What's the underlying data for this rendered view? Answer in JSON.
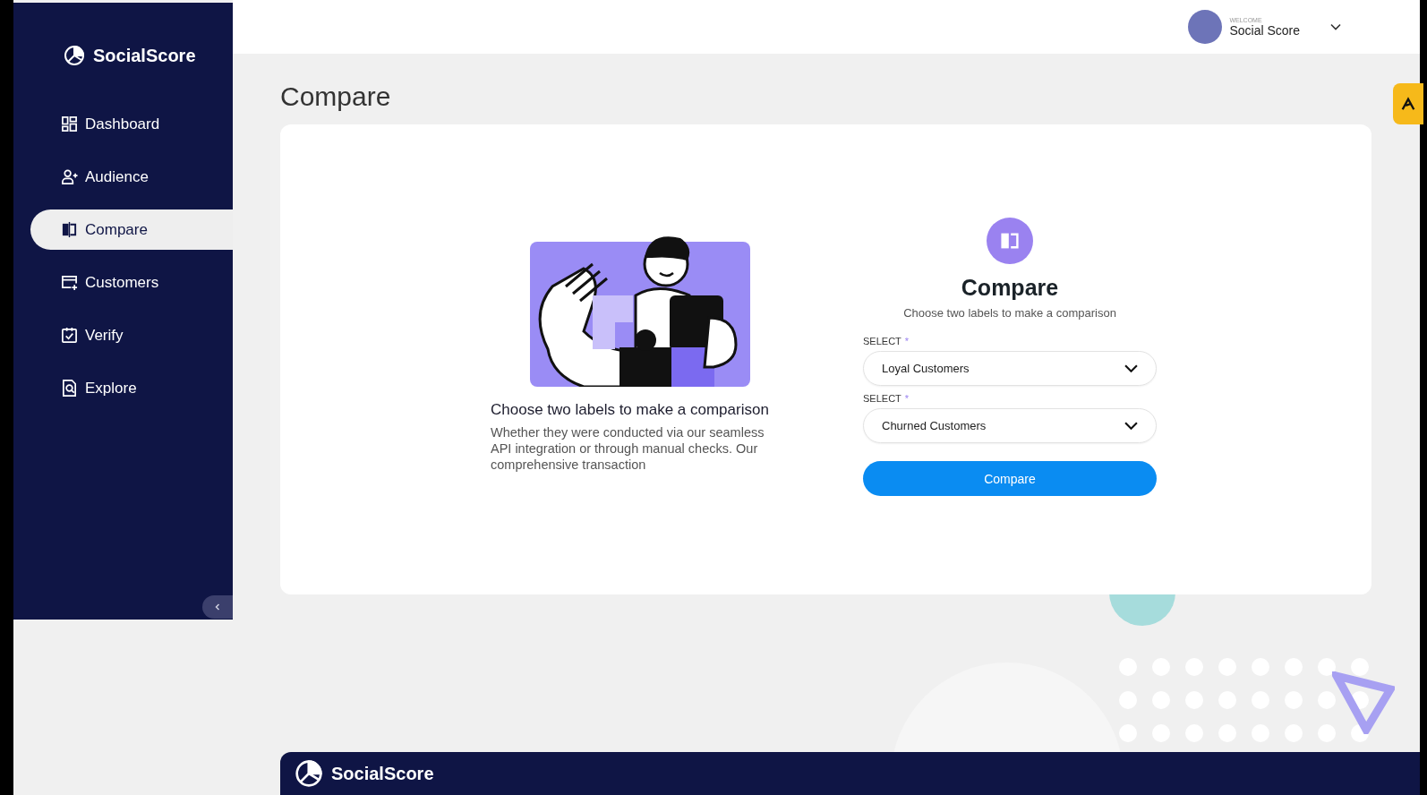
{
  "brand": "SocialScore",
  "nav": [
    {
      "label": "Dashboard",
      "kind": "dashboard",
      "selected": false
    },
    {
      "label": "Audience",
      "kind": "audience",
      "selected": false
    },
    {
      "label": "Compare",
      "kind": "compare",
      "selected": true
    },
    {
      "label": "Customers",
      "kind": "customers",
      "selected": false
    },
    {
      "label": "Verify",
      "kind": "verify",
      "selected": false
    },
    {
      "label": "Explore",
      "kind": "explore",
      "selected": false
    }
  ],
  "user": {
    "greeting": "WELCOME",
    "name": "Social Score"
  },
  "page_title": "Compare",
  "intro": {
    "heading": "Choose two labels to make a comparison",
    "body": "Whether they were conducted via our seamless API integration or through manual checks. Our comprehensive transaction"
  },
  "form": {
    "title": "Compare",
    "subtitle": "Choose two labels to make a comparison",
    "fields": [
      {
        "label": "SELECT",
        "required_mark": "*",
        "value": "Loyal Customers"
      },
      {
        "label": "SELECT",
        "required_mark": "*",
        "value": "Churned Customers"
      }
    ],
    "submit": "Compare"
  },
  "footer": {
    "brand": "SocialScore"
  }
}
